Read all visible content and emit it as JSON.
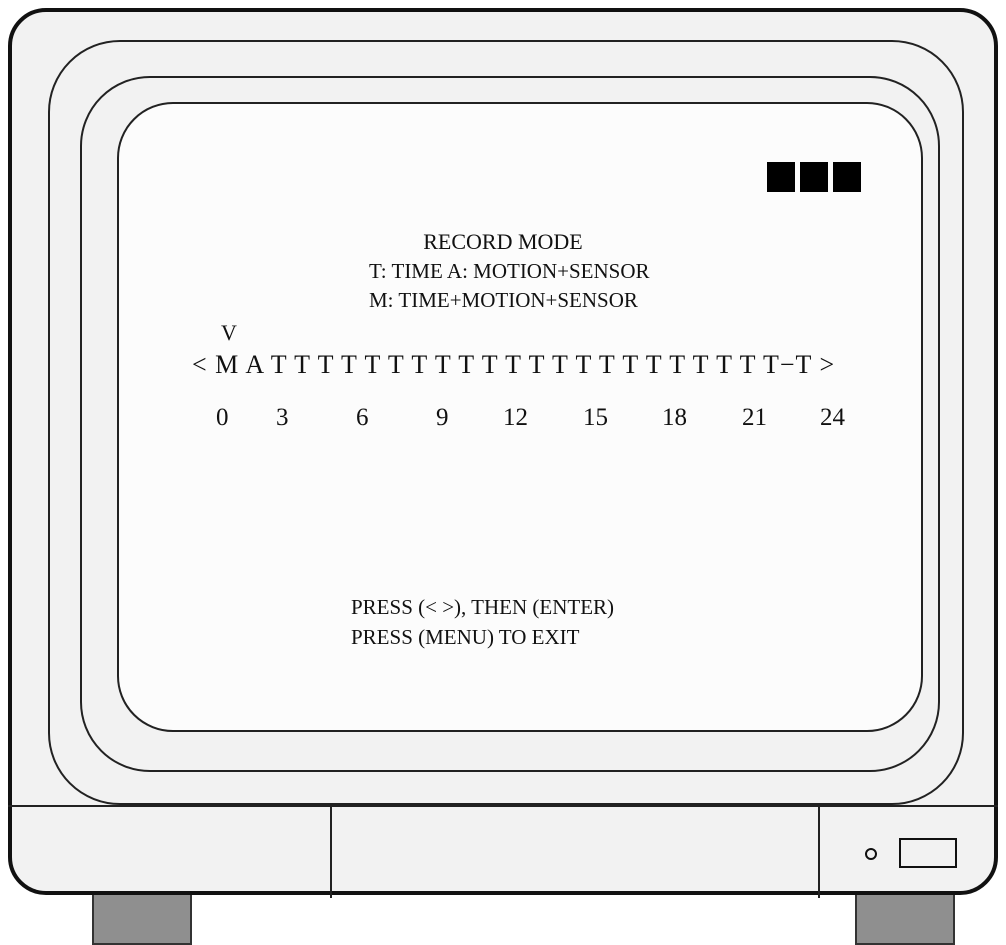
{
  "osd": {
    "title": "RECORD MODE",
    "legend_line1": "T: TIME    A: MOTION+SENSOR",
    "legend_line2": "M: TIME+MOTION+SENSOR",
    "cursor_marker": "V",
    "schedule_row": "< M A T T T T T T T T T T T T T T T T T T T T T T−T >",
    "hour_ticks": [
      "0",
      "3",
      "6",
      "9",
      "12",
      "15",
      "18",
      "21",
      "24"
    ],
    "instruction_line1": "PRESS (< >), THEN (ENTER)",
    "instruction_line2": "PRESS (MENU) TO EXIT"
  },
  "status": {
    "indicator_color": "#000000",
    "indicator_count": 3
  },
  "hardware": {
    "icons": [
      "power-led-icon",
      "power-button-icon"
    ]
  }
}
